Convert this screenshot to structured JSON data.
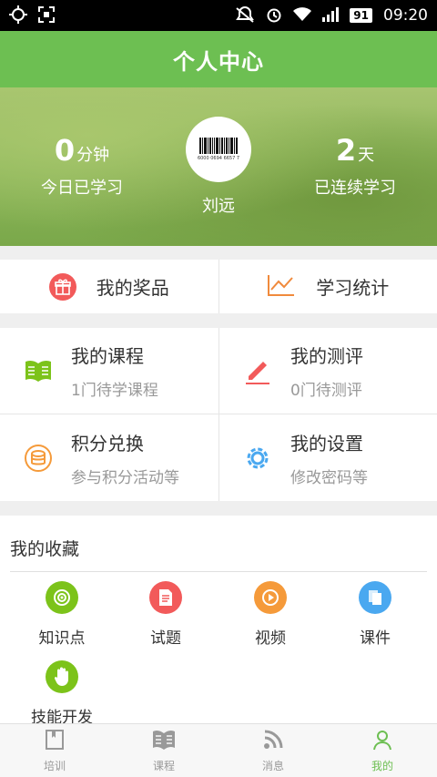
{
  "status_bar": {
    "time": "09:20",
    "battery": "91",
    "left_icons": [
      "crosshair-icon",
      "screenshot-icon"
    ],
    "right_icons": [
      "mute-icon",
      "alarm-icon",
      "wifi-icon",
      "signal-icon"
    ]
  },
  "header": {
    "title": "个人中心"
  },
  "hero": {
    "today_minutes": "0",
    "today_unit": "分钟",
    "today_label": "今日已学习",
    "streak_days": "2",
    "streak_unit": "天",
    "streak_label": "已连续学习",
    "user_name": "刘远",
    "barcode_text": "6000 0694 6657 7"
  },
  "quick": {
    "prizes_label": "我的奖品",
    "stats_label": "学习统计"
  },
  "grid": {
    "courses": {
      "title": "我的课程",
      "sub": "1门待学课程"
    },
    "evaluations": {
      "title": "我的测评",
      "sub": "0门待测评"
    },
    "points": {
      "title": "积分兑换",
      "sub": "参与积分活动等"
    },
    "settings": {
      "title": "我的设置",
      "sub": "修改密码等"
    }
  },
  "favorites": {
    "title": "我的收藏",
    "items": [
      {
        "label": "知识点",
        "color": "#7cc31a"
      },
      {
        "label": "试题",
        "color": "#f25a5a"
      },
      {
        "label": "视频",
        "color": "#f59a3a"
      },
      {
        "label": "课件",
        "color": "#4aa8f0"
      },
      {
        "label": "技能开发",
        "color": "#7cc31a"
      }
    ]
  },
  "tabs": [
    {
      "label": "培训"
    },
    {
      "label": "课程"
    },
    {
      "label": "消息"
    },
    {
      "label": "我的",
      "active": true
    }
  ],
  "colors": {
    "brand_green": "#6dbf52",
    "tab_inactive": "#999999"
  }
}
